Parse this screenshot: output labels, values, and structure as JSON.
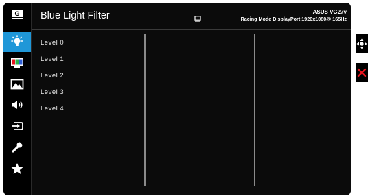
{
  "header": {
    "title": "Blue Light Filter",
    "model": "ASUS VG27v",
    "status": "Racing Mode DisplayPort 1920x1080@ 165Hz",
    "input_icon": "monitor-icon"
  },
  "sidebar": {
    "items": [
      {
        "icon": "gameplus-icon",
        "label": "G"
      },
      {
        "icon": "blue-light-icon"
      },
      {
        "icon": "color-icon"
      },
      {
        "icon": "image-icon"
      },
      {
        "icon": "sound-icon"
      },
      {
        "icon": "input-select-icon"
      },
      {
        "icon": "system-setup-icon"
      },
      {
        "icon": "favorite-icon"
      }
    ],
    "active_index": 1,
    "active_color": "#1f97d8"
  },
  "levels": [
    "Level 0",
    "Level 1",
    "Level 2",
    "Level 3",
    "Level 4"
  ],
  "controls": {
    "navigate_icon": "five-way-navigation-icon",
    "close_icon": "close-icon"
  },
  "colors": {
    "background": "#000000",
    "accent": "#1f97d8",
    "close": "#e8141e"
  }
}
